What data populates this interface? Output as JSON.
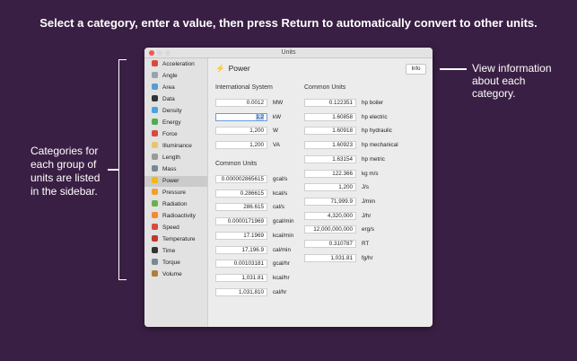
{
  "headline": "Select a category, enter a value, then press Return to automatically convert to other units.",
  "annotations": {
    "left": "Categories for each group of units are listed in the sidebar.",
    "right": "View information about each category."
  },
  "window": {
    "title": "Units"
  },
  "sidebar": {
    "items": [
      {
        "label": "Acceleration",
        "icon": "rocket-icon",
        "color": "#d64b3f"
      },
      {
        "label": "Angle",
        "icon": "protractor-icon",
        "color": "#9aa3ad"
      },
      {
        "label": "Area",
        "icon": "map-icon",
        "color": "#5a9bd8"
      },
      {
        "label": "Data",
        "icon": "computer-icon",
        "color": "#333333"
      },
      {
        "label": "Density",
        "icon": "molecule-icon",
        "color": "#48a4e0"
      },
      {
        "label": "Energy",
        "icon": "battery-icon",
        "color": "#4caf50"
      },
      {
        "label": "Force",
        "icon": "magnet-icon",
        "color": "#d64b3f"
      },
      {
        "label": "Illuminance",
        "icon": "candle-icon",
        "color": "#e9c46a"
      },
      {
        "label": "Length",
        "icon": "ruler-icon",
        "color": "#9a9a9a"
      },
      {
        "label": "Mass",
        "icon": "anchor-icon",
        "color": "#7b8794"
      },
      {
        "label": "Power",
        "icon": "lightning-icon",
        "color": "#f2b90e"
      },
      {
        "label": "Pressure",
        "icon": "burst-icon",
        "color": "#f0a030"
      },
      {
        "label": "Radiation",
        "icon": "radiation-ball-icon",
        "color": "#6ab04c"
      },
      {
        "label": "Radioactivity",
        "icon": "radioactive-icon",
        "color": "#f28c28"
      },
      {
        "label": "Speed",
        "icon": "race-car-icon",
        "color": "#d64b3f"
      },
      {
        "label": "Temperature",
        "icon": "thermometer-icon",
        "color": "#c0392b"
      },
      {
        "label": "Time",
        "icon": "stopwatch-icon",
        "color": "#333333"
      },
      {
        "label": "Torque",
        "icon": "wrench-icon",
        "color": "#7b8794"
      },
      {
        "label": "Volume",
        "icon": "box-icon",
        "color": "#b07d3a"
      }
    ],
    "selected": "Power"
  },
  "content": {
    "title": "Power",
    "info_label": "Info",
    "international": {
      "heading": "International System",
      "rows": [
        {
          "value": "0.0012",
          "unit": "MW"
        },
        {
          "value": "1.2",
          "unit": "kW"
        },
        {
          "value": "1,200",
          "unit": "W"
        },
        {
          "value": "1,200",
          "unit": "VA"
        }
      ]
    },
    "common_left": {
      "heading": "Common Units",
      "rows": [
        {
          "value": "0.000002865615",
          "unit": "gcal/s"
        },
        {
          "value": "0.286615",
          "unit": "kcal/s"
        },
        {
          "value": "286.615",
          "unit": "cal/s"
        },
        {
          "value": "0.0000171969",
          "unit": "gcal/min"
        },
        {
          "value": "17.1969",
          "unit": "kcal/min"
        },
        {
          "value": "17,196.9",
          "unit": "cal/min"
        },
        {
          "value": "0.00103181",
          "unit": "gcal/hr"
        },
        {
          "value": "1,031.81",
          "unit": "kcal/hr"
        },
        {
          "value": "1,031,810",
          "unit": "cal/hr"
        }
      ]
    },
    "common_right": {
      "heading": "Common Units",
      "rows": [
        {
          "value": "0.122351",
          "unit": "hp boiler"
        },
        {
          "value": "1.60858",
          "unit": "hp electric"
        },
        {
          "value": "1.60918",
          "unit": "hp hydraulic"
        },
        {
          "value": "1.60923",
          "unit": "hp mechanical"
        },
        {
          "value": "1.63154",
          "unit": "hp metric"
        },
        {
          "value": "122.366",
          "unit": "kg m/s"
        },
        {
          "value": "1,200",
          "unit": "J/s"
        },
        {
          "value": "71,999.9",
          "unit": "J/min"
        },
        {
          "value": "4,320,000",
          "unit": "J/hr"
        },
        {
          "value": "12,000,000,000",
          "unit": "erg/s"
        },
        {
          "value": "0.310787",
          "unit": "RT"
        },
        {
          "value": "1,031.81",
          "unit": "fg/hr"
        }
      ]
    }
  }
}
